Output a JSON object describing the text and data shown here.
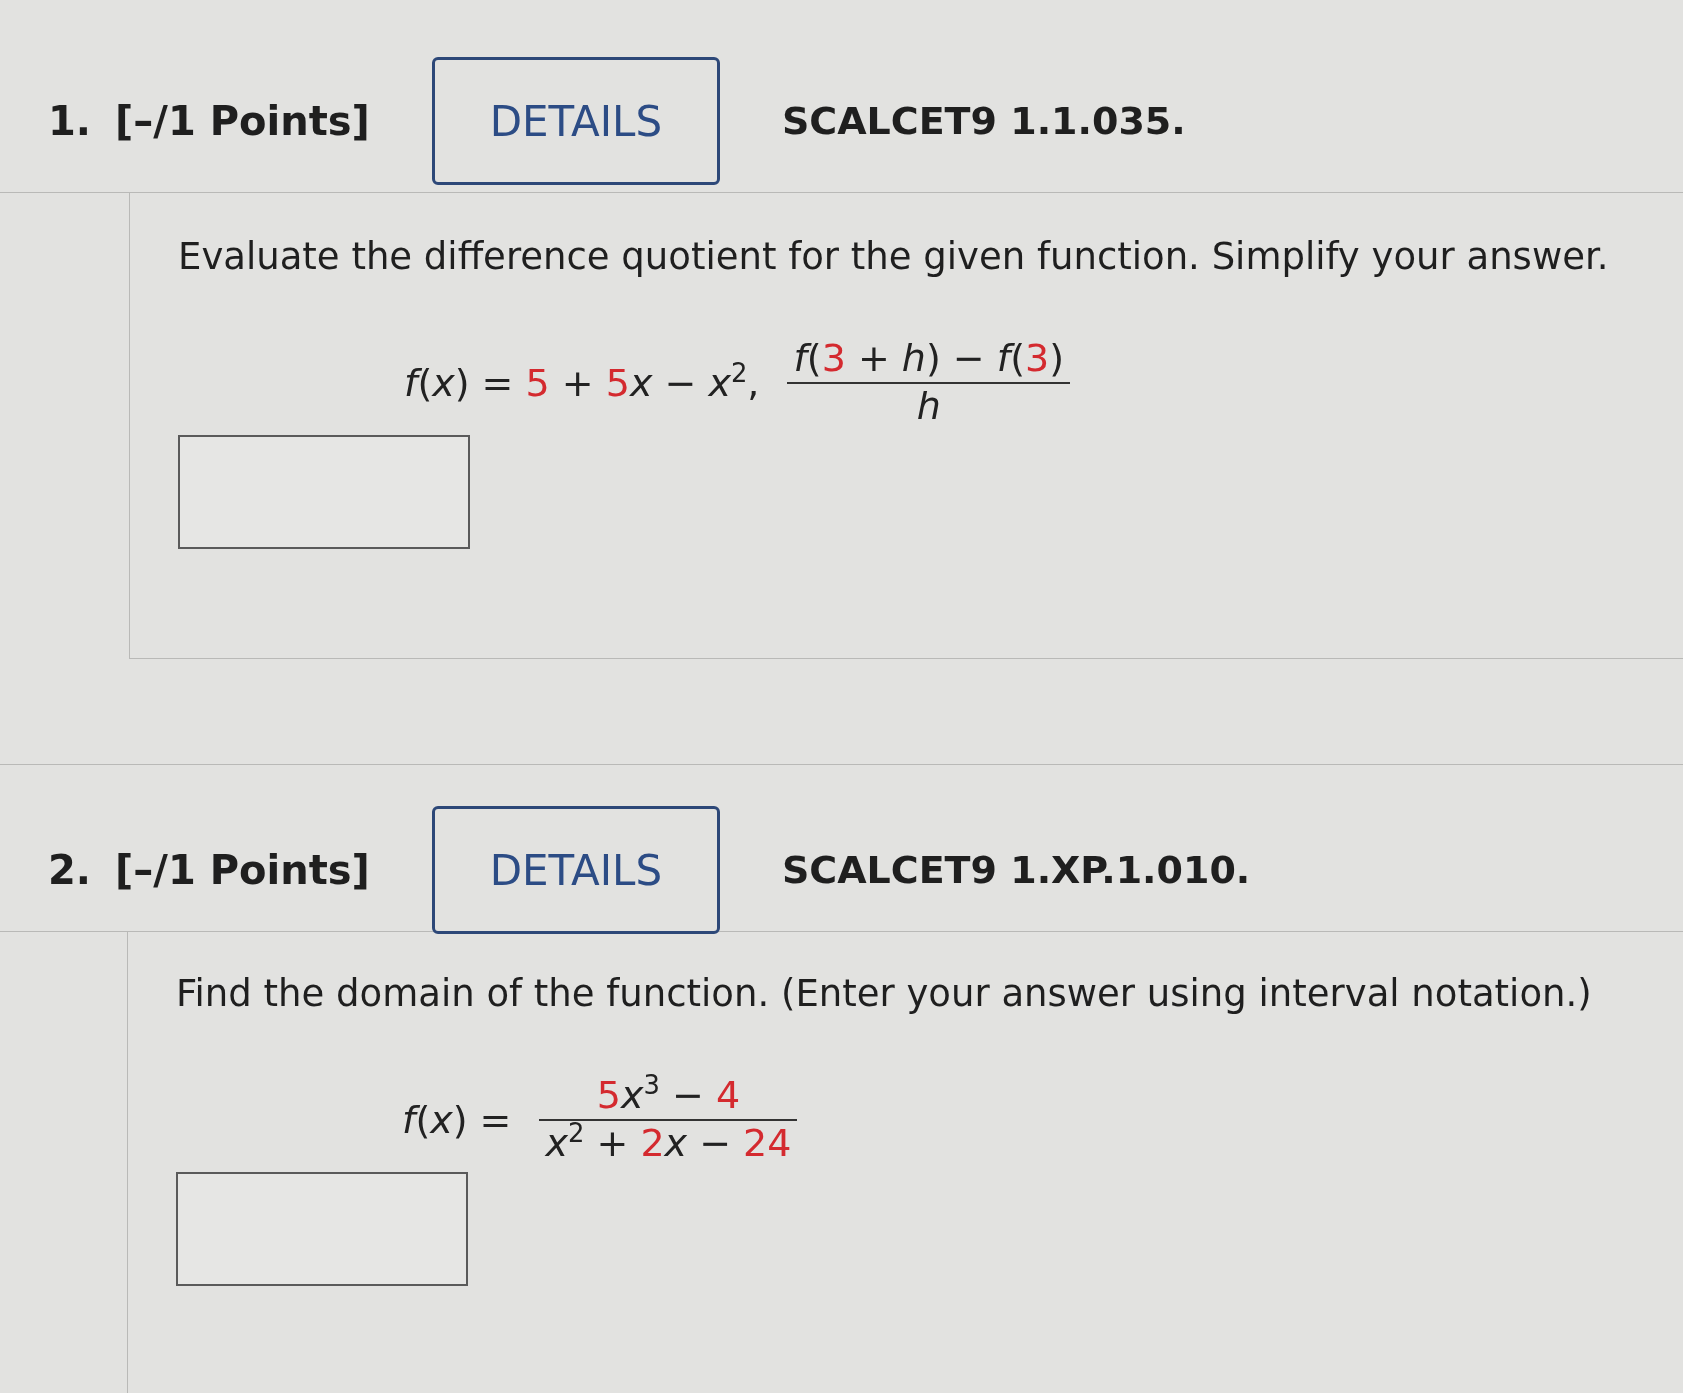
{
  "questions": [
    {
      "number": "1.",
      "points": "[–/1 Points]",
      "details_button": "DETAILS",
      "problem_code": "SCALCET9 1.1.035.",
      "prompt": "Evaluate the difference quotient for the given function. Simplify your answer.",
      "formula": {
        "inline": [
          {
            "text": "*f*(*x*) = ",
            "color": "#222222"
          },
          {
            "text": "5",
            "color": "#d42a2f"
          },
          {
            "text": " + ",
            "color": "#222222"
          },
          {
            "text": "5",
            "color": "#d42a2f"
          },
          {
            "text": "*x* − *x*$^{2}$,",
            "color": "#222222"
          }
        ],
        "fraction": {
          "numerator": [
            {
              "text": "*f*(",
              "color": "#222222"
            },
            {
              "text": "3",
              "color": "#d42a2f"
            },
            {
              "text": " + *h*) − *f*(",
              "color": "#222222"
            },
            {
              "text": "3",
              "color": "#d42a2f"
            },
            {
              "text": ")",
              "color": "#222222"
            }
          ],
          "denominator": [
            {
              "text": "*h*",
              "color": "#222222"
            }
          ]
        }
      }
    },
    {
      "number": "2.",
      "points": "[–/1 Points]",
      "details_button": "DETAILS",
      "problem_code": "SCALCET9 1.XP.1.010.",
      "prompt": "Find the domain of the function. (Enter your answer using interval notation.)",
      "formula": {
        "inline": [
          {
            "text": "*f*(*x*) =",
            "color": "#222222"
          }
        ],
        "fraction": {
          "numerator": [
            {
              "text": "5",
              "color": "#d42a2f"
            },
            {
              "text": "*x*$^{3}$ − ",
              "color": "#222222"
            },
            {
              "text": "4",
              "color": "#d42a2f"
            }
          ],
          "denominator": [
            {
              "text": "*x*$^{2}$ + ",
              "color": "#222222"
            },
            {
              "text": "2",
              "color": "#d42a2f"
            },
            {
              "text": "*x* − ",
              "color": "#222222"
            },
            {
              "text": "24",
              "color": "#d42a2f"
            }
          ]
        }
      }
    }
  ]
}
